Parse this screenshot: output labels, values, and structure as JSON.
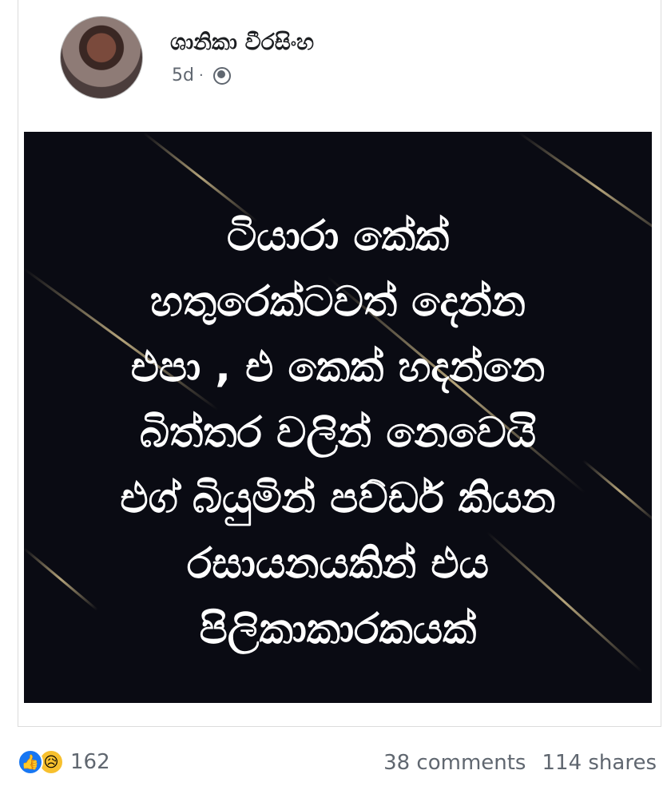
{
  "post": {
    "author_name": "ශානිකා වීරසිංහ",
    "time": "5d",
    "separator": "·",
    "privacy_icon": "globe-icon",
    "image_text": "ටියාරා කේක්\nහතුරෙක්ටවත් දෙන්න\nඑපා , එ කෙක් හදන්නෙ\nබිත්තර වලින් නෙවෙයි\nඑග් බියුමින් පව්ඩර් කියන\nරසායනයකින් එය\nපිලිකාකාරකයක්"
  },
  "footer": {
    "reaction_icons": [
      "like-icon",
      "sad-icon"
    ],
    "reaction_count": "162",
    "comments": "38 comments",
    "shares": "114 shares"
  },
  "colors": {
    "image_background": "#0a0b13",
    "like_blue": "#1877f2",
    "meta_gray": "#606770"
  }
}
